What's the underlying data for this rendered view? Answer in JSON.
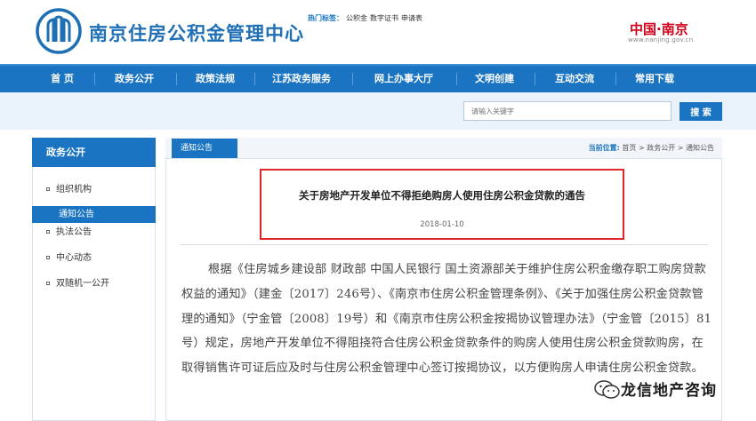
{
  "header": {
    "site_title": "南京住房公积金管理中心",
    "brand": "中国·南京",
    "brand_url": "www.nanjing.gov.cn"
  },
  "nav": {
    "items": [
      "首 页",
      "政务公开",
      "政策法规",
      "江苏政务服务",
      "网上办事大厅",
      "文明创建",
      "互动交流",
      "常用下载"
    ]
  },
  "tagbar": {
    "hot_label": "热门标签：",
    "tags": [
      "公积金",
      "数字证书",
      "申请表"
    ],
    "search_placeholder": "请输入关键字",
    "search_button": "搜 索"
  },
  "sidebar": {
    "title": "政务公开",
    "items": [
      "组织机构",
      "通知公告",
      "执法公告",
      "中心动态",
      "双随机一公开"
    ],
    "active_index": 1
  },
  "content": {
    "tab_label": "通知公告",
    "breadcrumb_label": "当前位置:",
    "breadcrumb": "首页 > 政务公开 > 通知公告",
    "title": "关于房地产开发单位不得拒绝购房人使用住房公积金贷款的通告",
    "date": "2018-01-10",
    "body": "根据《住房城乡建设部 财政部 中国人民银行 国土资源部关于维护住房公积金缴存职工购房贷款权益的通知》（建金〔2017〕246号）、《南京市住房公积金管理条例》、《关于加强住房公积金贷款管理的通知》（宁金管〔2008〕19号）和《南京市住房公积金按揭协议管理办法》（宁金管〔2015〕81号）规定，房地产开发单位不得阻挠符合住房公积金贷款条件的购房人使用住房公积金贷款购房，在取得销售许可证后应及时与住房公积金管理中心签订按揭协议，以方便购房人申请住房公积金贷款。"
  },
  "watermark": {
    "text": "龙信地产咨询"
  },
  "colors": {
    "primary": "#1a74c1",
    "highlight_border": "#e0262a",
    "brand_red": "#d0021b"
  }
}
